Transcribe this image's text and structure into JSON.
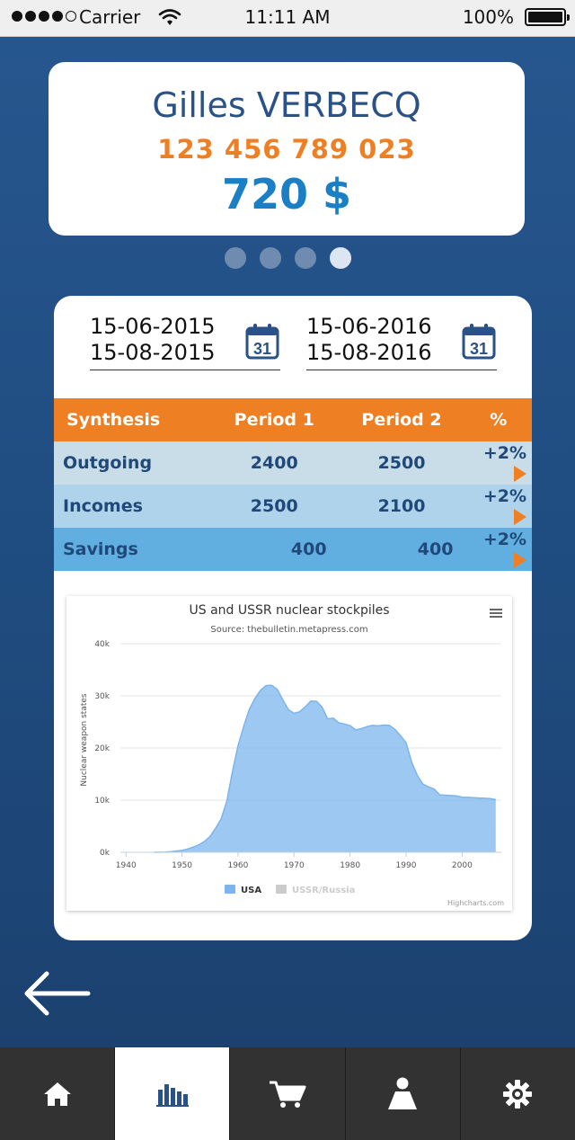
{
  "status_bar": {
    "carrier": "Carrier",
    "time": "11:11 AM",
    "battery": "100%"
  },
  "account": {
    "name": "Gilles VERBECQ",
    "number": "123 456 789 023",
    "balance": "720 $"
  },
  "pager": {
    "count": 4,
    "active_index": 3
  },
  "periods": [
    {
      "start": "15-06-2015",
      "end": "15-08-2015",
      "calendar_day": "31"
    },
    {
      "start": "15-06-2016",
      "end": "15-08-2016",
      "calendar_day": "31"
    }
  ],
  "table": {
    "headers": [
      "Synthesis",
      "Period 1",
      "Period 2",
      "%"
    ],
    "rows": [
      {
        "label": "Outgoing",
        "p1": "2400",
        "p2": "2500",
        "pct": "+2%"
      },
      {
        "label": "Incomes",
        "p1": "2500",
        "p2": "2100",
        "pct": "+2%"
      },
      {
        "label": "Savings",
        "p1": "400",
        "p2": "400",
        "pct": "+2%"
      }
    ]
  },
  "chart_data": {
    "type": "area",
    "title": "US and USSR nuclear stockpiles",
    "subtitle": "Source: thebulletin.metapress.com",
    "ylabel": "Nuclear weapon states",
    "xlabel": "",
    "x_ticks": [
      "1940",
      "1950",
      "1960",
      "1970",
      "1980",
      "1990",
      "2000"
    ],
    "y_ticks": [
      "0k",
      "10k",
      "20k",
      "30k",
      "40k"
    ],
    "xlim": [
      1939,
      2007
    ],
    "ylim": [
      0,
      40000
    ],
    "grid": true,
    "legend_position": "bottom",
    "credits": "Highcharts.com",
    "series": [
      {
        "name": "USA",
        "color": "#7cb5ec",
        "x": [
          1945,
          1946,
          1947,
          1948,
          1949,
          1950,
          1951,
          1952,
          1953,
          1954,
          1955,
          1956,
          1957,
          1958,
          1959,
          1960,
          1961,
          1962,
          1963,
          1964,
          1965,
          1966,
          1967,
          1968,
          1969,
          1970,
          1971,
          1972,
          1973,
          1974,
          1975,
          1976,
          1977,
          1978,
          1979,
          1980,
          1981,
          1982,
          1983,
          1984,
          1985,
          1986,
          1987,
          1988,
          1989,
          1990,
          1991,
          1992,
          1993,
          1994,
          1995,
          1996,
          1997,
          1998,
          1999,
          2000,
          2001,
          2002,
          2003,
          2004,
          2005,
          2006
        ],
        "values": [
          6,
          11,
          32,
          110,
          235,
          369,
          640,
          1005,
          1436,
          2063,
          3057,
          4618,
          6444,
          9822,
          15468,
          20434,
          24126,
          27387,
          29459,
          31056,
          31982,
          32040,
          31233,
          29224,
          27342,
          26662,
          26956,
          27912,
          28999,
          28965,
          27826,
          25579,
          25722,
          24826,
          24605,
          24304,
          23464,
          23708,
          24099,
          24357,
          24237,
          24401,
          24344,
          23586,
          22380,
          21004,
          17287,
          14747,
          13076,
          12555,
          12144,
          11009,
          10950,
          10871,
          10824,
          10577,
          10527,
          10475,
          10421,
          10358,
          10295,
          10104
        ]
      },
      {
        "name": "USSR/Russia",
        "color": "#cccccc",
        "visible": false
      }
    ]
  },
  "nav": {
    "back_icon": "arrow-left-icon",
    "tabs": [
      {
        "name": "home",
        "icon": "home-icon",
        "active": false
      },
      {
        "name": "stats",
        "icon": "bar-chart-icon",
        "active": true
      },
      {
        "name": "cart",
        "icon": "cart-icon",
        "active": false
      },
      {
        "name": "profile",
        "icon": "person-icon",
        "active": false
      },
      {
        "name": "settings",
        "icon": "gear-icon",
        "active": false
      }
    ],
    "colors": {
      "bar": "#333232",
      "active": "#ffffff",
      "icon": "#ffffff",
      "active_icon": "#2a5286"
    }
  },
  "colors": {
    "brand_blue": "#2a5286",
    "accent_orange": "#ef7f23",
    "balance_blue": "#1a7fc5"
  }
}
